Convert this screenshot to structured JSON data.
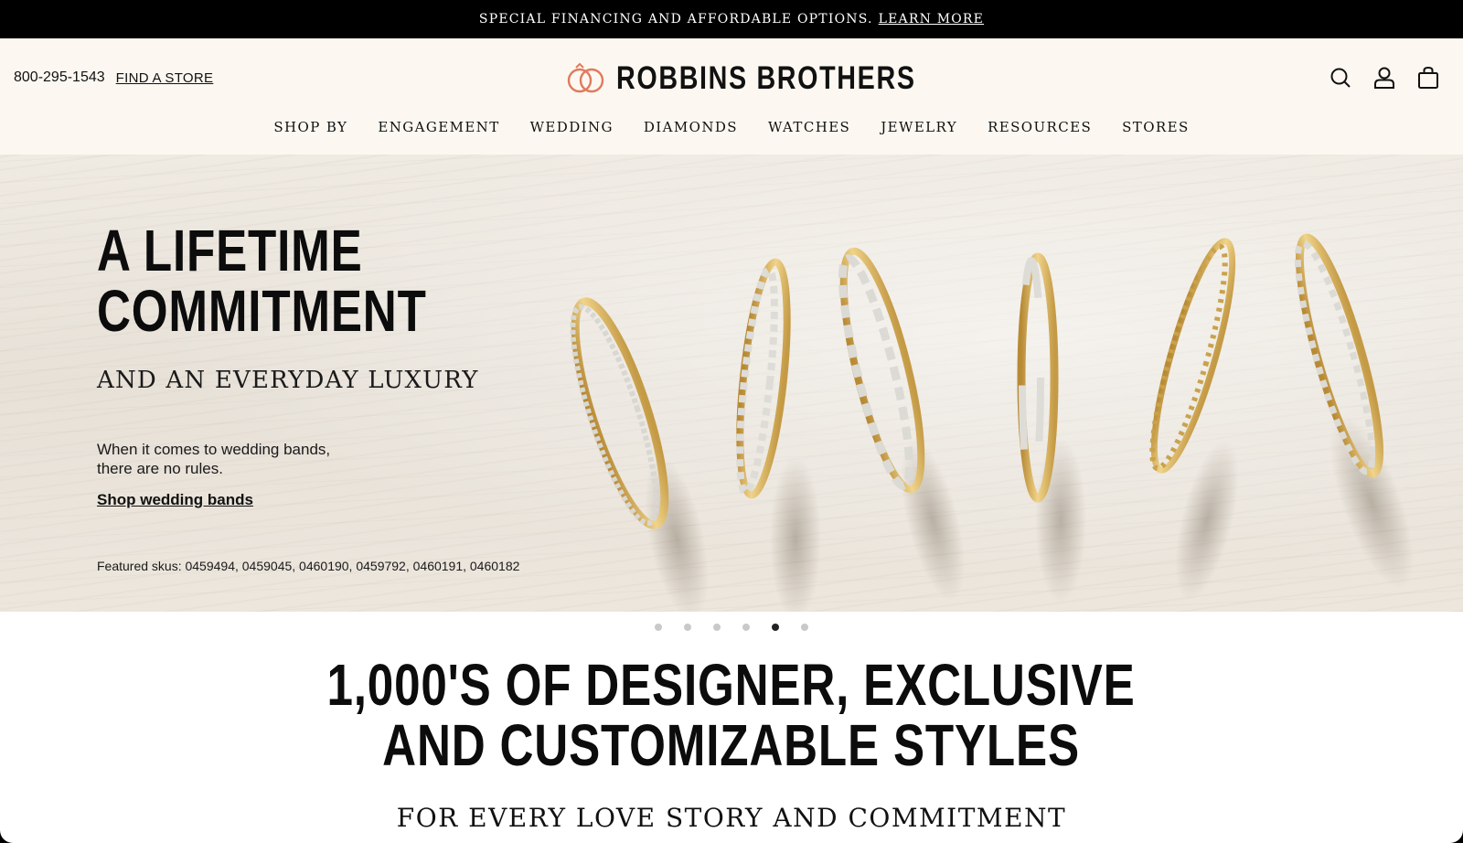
{
  "promo": {
    "text": "SPECIAL FINANCING AND AFFORDABLE OPTIONS.",
    "link": "LEARN MORE"
  },
  "header": {
    "phone": "800-295-1543",
    "find_store": "FIND A STORE",
    "brand": "ROBBINS BROTHERS",
    "icons": [
      "search-icon",
      "account-icon",
      "bag-icon"
    ],
    "nav": [
      "SHOP BY",
      "ENGAGEMENT",
      "WEDDING",
      "DIAMONDS",
      "WATCHES",
      "JEWELRY",
      "RESOURCES",
      "STORES"
    ]
  },
  "hero": {
    "title_line1": "A LIFETIME",
    "title_line2": "COMMITMENT",
    "subtitle": "AND AN EVERYDAY LUXURY",
    "body_line1": "When it comes to wedding bands,",
    "body_line2": "there are no rules.",
    "cta": "Shop wedding bands",
    "skus": "Featured skus: 0459494, 0459045, 0460190, 0459792, 0460191, 0460182"
  },
  "carousel": {
    "slide_count": 6,
    "active_index": 4
  },
  "section": {
    "title_line1": "1,000'S OF DESIGNER, EXCLUSIVE",
    "title_line2": "AND CUSTOMIZABLE STYLES",
    "subtitle": "FOR EVERY LOVE STORY AND COMMITMENT"
  },
  "colors": {
    "promo_bg": "#000000",
    "header_bg": "#fcf8f1",
    "logo_accent": "#e07a5f",
    "gold": "#d8b25c"
  }
}
